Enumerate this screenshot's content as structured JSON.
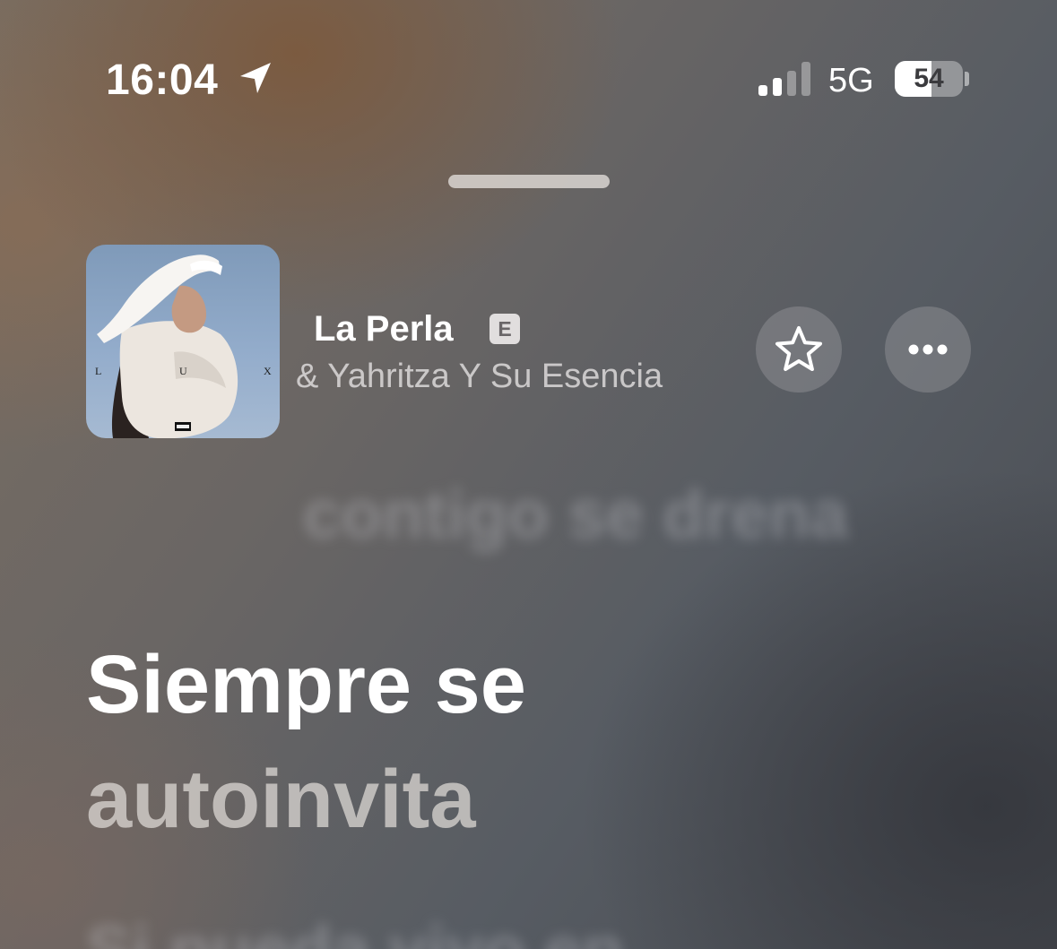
{
  "status_bar": {
    "time": "16:04",
    "location_icon": "location-arrow-icon",
    "signal_icon": "cellular-signal-icon",
    "signal_bars_active": 2,
    "signal_bars_total": 4,
    "network": "5G",
    "battery_percent": "54",
    "battery_level": 0.54
  },
  "now_playing": {
    "title": "La Perla",
    "explicit_badge": "E",
    "artist": "& Yahritza Y Su Esencia",
    "artwork_letters": [
      "L",
      "U",
      "X"
    ],
    "favorite_icon": "star-icon",
    "more_icon": "ellipsis-icon"
  },
  "lyrics": {
    "previous_line": "contigo se drena",
    "current_line_1": "Siempre se",
    "current_line_2": "autoinvita",
    "next_line": "Si pueda vivo en"
  },
  "colors": {
    "text_primary": "#ffffff",
    "text_secondary": "#e1dede",
    "button_bg": "#96969b"
  }
}
